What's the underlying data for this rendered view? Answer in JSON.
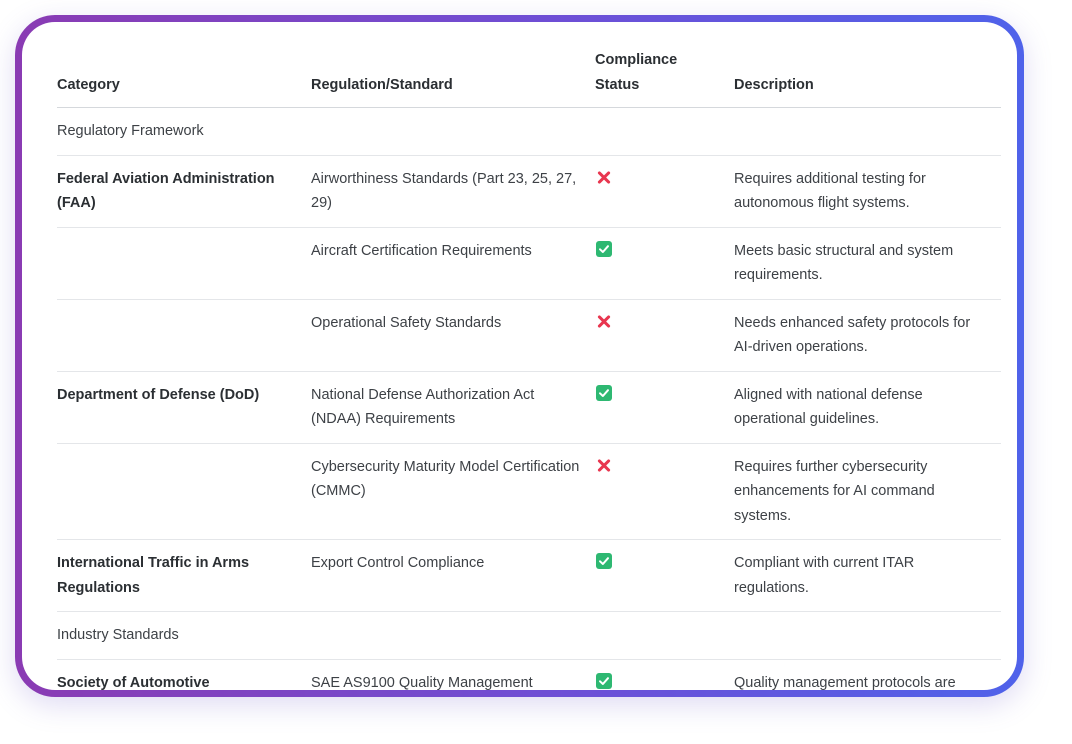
{
  "table": {
    "headers": {
      "category": "Category",
      "regulation": "Regulation/Standard",
      "status_line1": "Compliance",
      "status_line2": "Status",
      "description": "Description"
    },
    "rows": [
      {
        "type": "section",
        "category": "Regulatory Framework"
      },
      {
        "type": "entry",
        "category": "Federal Aviation Administration (FAA)",
        "regulation": "Airworthiness Standards (Part 23, 25, 27, 29)",
        "status": "non-compliant",
        "status_icon": "cross-icon",
        "description": "Requires additional testing for autonomous flight systems."
      },
      {
        "type": "entry",
        "category": "",
        "regulation": "Aircraft Certification Requirements",
        "status": "compliant",
        "status_icon": "check-icon",
        "description": "Meets basic structural and system requirements."
      },
      {
        "type": "entry",
        "category": "",
        "regulation": "Operational Safety Standards",
        "status": "non-compliant",
        "status_icon": "cross-icon",
        "description": "Needs enhanced safety protocols for AI-driven operations."
      },
      {
        "type": "entry",
        "category": "Department of Defense (DoD)",
        "regulation": "National Defense Authorization Act (NDAA) Requirements",
        "status": "compliant",
        "status_icon": "check-icon",
        "description": "Aligned with national defense operational guidelines."
      },
      {
        "type": "entry",
        "category": "",
        "regulation": "Cybersecurity Maturity Model Certification (CMMC)",
        "status": "non-compliant",
        "status_icon": "cross-icon",
        "description": "Requires further cybersecurity enhancements for AI command systems."
      },
      {
        "type": "entry",
        "category": "International Traffic in Arms Regulations",
        "regulation": "Export Control Compliance",
        "status": "compliant",
        "status_icon": "check-icon",
        "description": "Compliant with current ITAR regulations."
      },
      {
        "type": "section",
        "category": "Industry Standards"
      },
      {
        "type": "entry",
        "category": "Society of Automotive",
        "regulation": "SAE AS9100 Quality Management",
        "status": "compliant",
        "status_icon": "check-icon",
        "description": "Quality management protocols are"
      }
    ]
  },
  "colors": {
    "frame_gradient_start": "#8a3bb3",
    "frame_gradient_end": "#4f62ea",
    "cross": "#e8364f",
    "check": "#2eb872"
  }
}
